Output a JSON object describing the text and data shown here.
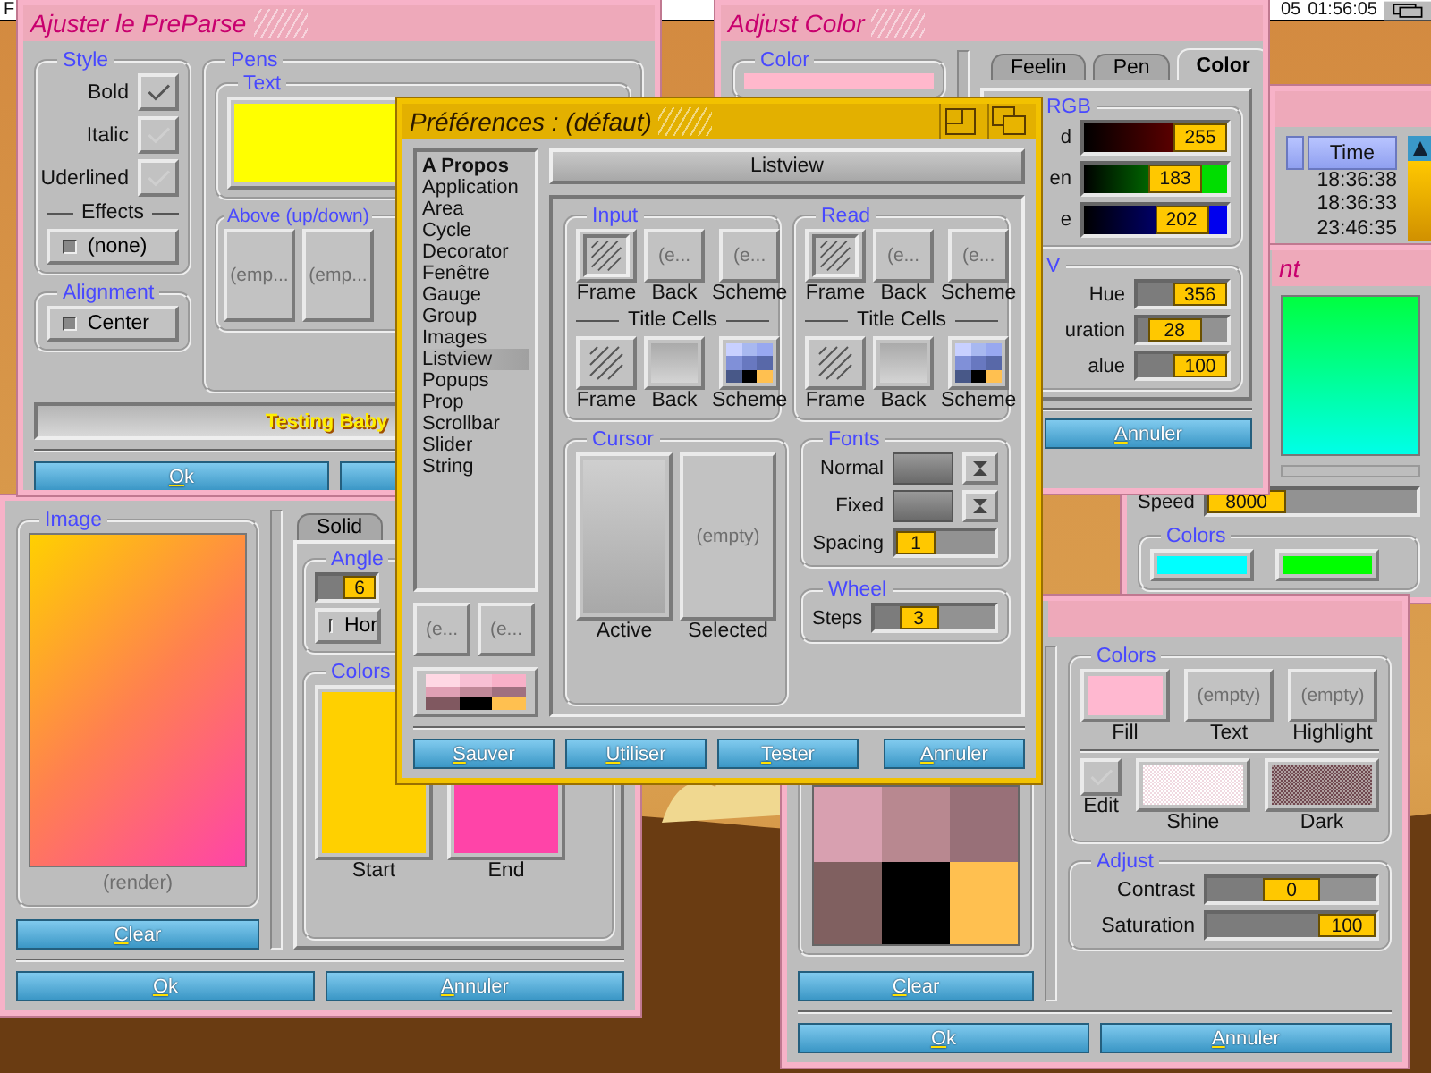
{
  "menubar": {
    "left": "F",
    "date": "05",
    "time": "01:56:05"
  },
  "preparse_window": {
    "title": "Ajuster le PreParse",
    "style_group": {
      "title": "Style",
      "checkboxes": [
        {
          "label": "Bold",
          "checked": true
        },
        {
          "label": "Italic",
          "checked": false
        },
        {
          "label": "Uderlined",
          "checked": false
        }
      ],
      "effects_label": "Effects",
      "effects_value": "(none)"
    },
    "alignment_group": {
      "title": "Alignment",
      "value": "Center"
    },
    "pens_group": {
      "title": "Pens",
      "text_group": {
        "title": "Text",
        "color": "#ffff00"
      },
      "above_group": {
        "title": "Above (up/down)",
        "buttons": [
          "(emp...",
          "(emp..."
        ]
      }
    },
    "preview_text": "Testing Baby",
    "buttons": [
      "Ok"
    ]
  },
  "adjust_color_window": {
    "title": "Adjust Color",
    "color_group": {
      "title": "Color",
      "color": "#ffb8cc"
    },
    "tabs": [
      {
        "label": "Feelin",
        "selected": false
      },
      {
        "label": "Pen",
        "selected": false
      },
      {
        "label": "Color",
        "selected": true
      }
    ],
    "rgb_group": {
      "title": "RGB",
      "sliders": [
        {
          "label": "d",
          "value": "255",
          "level": 1
        },
        {
          "label": "en",
          "value": "183",
          "level": 0.72
        },
        {
          "label": "e",
          "value": "202",
          "level": 0.79
        }
      ]
    },
    "hsv_group": {
      "title": "V",
      "sliders": [
        {
          "label": "Hue",
          "value": "356",
          "level": 0.99
        },
        {
          "label": "uration",
          "value": "28",
          "level": 0.28
        },
        {
          "label": "alue",
          "value": "100",
          "level": 1
        }
      ]
    },
    "buttons": [
      "Annuler"
    ]
  },
  "list_window": {
    "columns": [
      "Time"
    ],
    "rows": [
      "18:36:38",
      "18:36:33",
      "23:46:35"
    ]
  },
  "gradient_window": {
    "title": "nt",
    "speed": {
      "label": "Speed",
      "value": "8000",
      "level": 0
    },
    "colors_group": {
      "title": "Colors",
      "swatches": [
        {
          "color": "#00ffff"
        },
        {
          "color": "#00ff00"
        }
      ]
    }
  },
  "gradient_editor_window": {
    "image_group": {
      "title": "Image",
      "caption": "(render)"
    },
    "clear_button": "Clear",
    "tabs": [
      {
        "label": "Solid",
        "selected": false
      }
    ],
    "angle_group": {
      "title": "Angle",
      "value": "6",
      "level": 1,
      "mode": "Hor"
    },
    "colors_group": {
      "title": "Colors",
      "swatches": [
        {
          "label": "Start",
          "color": "#ffd000"
        },
        {
          "label": "End",
          "color": "#ff44a8"
        }
      ]
    },
    "buttons": [
      "Ok",
      "Annuler"
    ]
  },
  "scheme_window": {
    "clear_button": "Clear",
    "colors_group": {
      "title": "Colors",
      "pens": [
        {
          "label": "Fill",
          "kind": "color",
          "color": "#ffb8d0"
        },
        {
          "label": "Text",
          "kind": "empty",
          "empty_text": "(empty)"
        },
        {
          "label": "Highlight",
          "kind": "empty",
          "empty_text": "(empty)"
        }
      ],
      "edit": {
        "label": "Edit",
        "checked": false
      },
      "patterns": [
        {
          "label": "Shine",
          "kind": "shine"
        },
        {
          "label": "Dark",
          "kind": "dark"
        }
      ]
    },
    "adjust_group": {
      "title": "Adjust",
      "sliders": [
        {
          "label": "Contrast",
          "value": "0",
          "level": 0.5
        },
        {
          "label": "Saturation",
          "value": "100",
          "level": 1
        }
      ]
    },
    "buttons": [
      "Ok",
      "Annuler"
    ]
  },
  "preferences_window": {
    "title": "Préférences : (défaut)",
    "sections": [
      {
        "label": "A Propos",
        "kind": "heading",
        "selected": false
      },
      {
        "label": "Application",
        "kind": "item",
        "selected": false
      },
      {
        "label": "Area",
        "kind": "item",
        "selected": false
      },
      {
        "label": "Cycle",
        "kind": "item",
        "selected": false
      },
      {
        "label": "Decorator",
        "kind": "item",
        "selected": false
      },
      {
        "label": "Fenêtre",
        "kind": "item",
        "selected": false
      },
      {
        "label": "Gauge",
        "kind": "item",
        "selected": false
      },
      {
        "label": "Group",
        "kind": "item",
        "selected": false
      },
      {
        "label": "Images",
        "kind": "item",
        "selected": false
      },
      {
        "label": "Listview",
        "kind": "item",
        "selected": true
      },
      {
        "label": "Popups",
        "kind": "item",
        "selected": false
      },
      {
        "label": "Prop",
        "kind": "item",
        "selected": false
      },
      {
        "label": "Scrollbar",
        "kind": "item",
        "selected": false
      },
      {
        "label": "Slider",
        "kind": "item",
        "selected": false
      },
      {
        "label": "String",
        "kind": "item",
        "selected": false
      }
    ],
    "side_buttons": [
      "(e...",
      "(e..."
    ],
    "page_title": "Listview",
    "groups": [
      {
        "title": "Input",
        "items": [
          {
            "label": "Frame",
            "kind": "frame_inset"
          },
          {
            "label": "Back",
            "kind": "empty",
            "empty_text": "(e..."
          },
          {
            "label": "Scheme",
            "kind": "empty",
            "empty_text": "(e..."
          }
        ],
        "subtitle": "Title Cells",
        "cells": [
          {
            "label": "Frame",
            "kind": "frame"
          },
          {
            "label": "Back",
            "kind": "back"
          },
          {
            "label": "Scheme",
            "kind": "scheme"
          }
        ]
      },
      {
        "title": "Read",
        "items": [
          {
            "label": "Frame",
            "kind": "frame_inset"
          },
          {
            "label": "Back",
            "kind": "empty",
            "empty_text": "(e..."
          },
          {
            "label": "Scheme",
            "kind": "empty",
            "empty_text": "(e..."
          }
        ],
        "subtitle": "Title Cells",
        "cells": [
          {
            "label": "Frame",
            "kind": "frame"
          },
          {
            "label": "Back",
            "kind": "back"
          },
          {
            "label": "Scheme",
            "kind": "scheme"
          }
        ]
      }
    ],
    "cursor_group": {
      "title": "Cursor",
      "items": [
        {
          "label": "Active",
          "kind": "back"
        },
        {
          "label": "Selected",
          "kind": "empty",
          "empty_text": "(empty)"
        }
      ]
    },
    "fonts_group": {
      "title": "Fonts",
      "fields": [
        {
          "label": "Normal"
        },
        {
          "label": "Fixed"
        }
      ],
      "spacing": {
        "label": "Spacing",
        "value": "1",
        "level": 0
      }
    },
    "wheel_group": {
      "title": "Wheel",
      "steps": {
        "label": "Steps",
        "value": "3",
        "level": 0.3
      }
    },
    "buttons": [
      "Sauver",
      "Utiliser",
      "Tester",
      "Annuler"
    ]
  }
}
